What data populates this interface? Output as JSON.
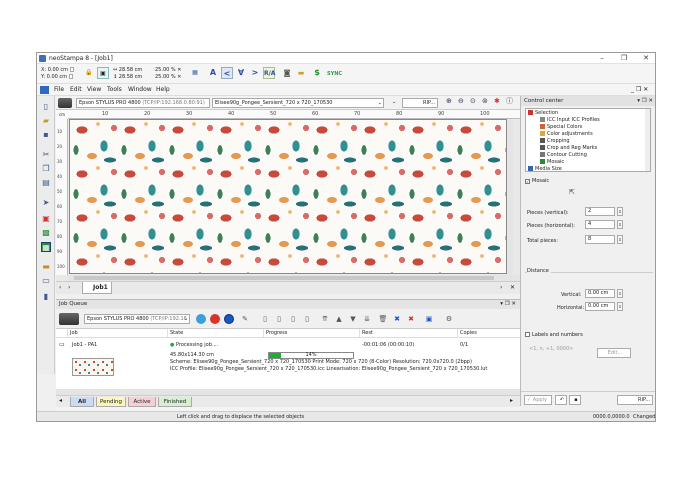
{
  "window": {
    "title": "neoStampa 8 - [Job1]",
    "controls": {
      "minimize": "–",
      "maximize": "❐",
      "close": "✕"
    }
  },
  "toolbar": {
    "pos_x": "0.00 cm",
    "pos_y": "0.00 cm",
    "size_w": "28.58 cm",
    "size_h": "28.58 cm",
    "scale_x": "25.00 %",
    "scale_y": "25.00 %",
    "sync_label": "SYNC"
  },
  "menu": {
    "items": [
      "File",
      "Edit",
      "View",
      "Tools",
      "Window",
      "Help"
    ],
    "mdi_controls": "_ ❐ ✕"
  },
  "document": {
    "printer": "Epson STYLUS PRO 4800",
    "printer_addr": "(TCP/IP:192.168.0.80:91)",
    "profile": "Elisee90g_Pongee_Sersient_720 x 720_170530",
    "rip_label": "RIP...",
    "ruler_unit": "cm",
    "ruler_ticks_h": [
      "10",
      "20",
      "30",
      "40",
      "50",
      "60",
      "70",
      "80",
      "90",
      "100"
    ],
    "ruler_ticks_v": [
      "10",
      "20",
      "30",
      "40",
      "50",
      "60",
      "70",
      "80",
      "90",
      "100"
    ],
    "tab_label": "Job1"
  },
  "job_queue": {
    "title": "Job Queue",
    "printer": "Epson STYLUS PRO 4800",
    "printer_addr": "(TCP/IP:192.16",
    "columns": [
      "Job",
      "State",
      "Progress",
      "Rest",
      "Copies"
    ],
    "rows": [
      {
        "job": "Job1 - PA1",
        "state": "Processing job....",
        "progress_pct": 14,
        "progress_label": "14%",
        "rest": "-00:01:06 (00:00:10)",
        "copies": "0/1",
        "size": "45.80x114.30 cm",
        "scheme_line": "Scheme: Elisee90g_Pongee_Sersient_720 x 720_170530   Print Mode: 720 x 720 (8-Color)   Resolution: 720.0x720.0 (2bpp)",
        "icc_line": "ICC Profile: Elisee90g_Pongee_Sersient_720 x 720_170530.icc   Linearisation: Elisee90g_Pongee_Sersient_720 x 720_170530.lut"
      }
    ],
    "filters": [
      "All",
      "Pending",
      "Active",
      "Finished"
    ]
  },
  "control_center": {
    "title": "Control center",
    "tree": [
      {
        "label": "Selection",
        "level": 0
      },
      {
        "label": "ICC Input ICC Profiles",
        "level": 1
      },
      {
        "label": "Special Colors",
        "level": 1
      },
      {
        "label": "Color adjustments",
        "level": 1
      },
      {
        "label": "Cropping",
        "level": 1
      },
      {
        "label": "Crop and Reg Marks",
        "level": 1
      },
      {
        "label": "Contour Cutting",
        "level": 1
      },
      {
        "label": "Mosaic",
        "level": 1
      },
      {
        "label": "Media Size",
        "level": 0
      }
    ],
    "mosaic_label": "Mosaic",
    "pieces_vertical_label": "Pieces (vertical):",
    "pieces_vertical": "2",
    "pieces_horizontal_label": "Pieces (horizontal):",
    "pieces_horizontal": "4",
    "total_pieces_label": "Total pieces:",
    "total_pieces": "8",
    "distance_label": "Distance",
    "vertical_label": "Vertical:",
    "vertical_value": "0.00 cm",
    "horizontal_label": "Horizontal:",
    "horizontal_value": "0.00 cm",
    "labels_numbers_label": "Labels and numbers",
    "labels_placeholder": "<1, n, +1, 0000>",
    "edit_label": "Edit...",
    "apply_label": "Apply",
    "rip_label": "RIP..."
  },
  "status": {
    "hint": "Left click and drag to displace the selected objects",
    "coords": "0000.0,0000.0",
    "changed": "Changed"
  }
}
